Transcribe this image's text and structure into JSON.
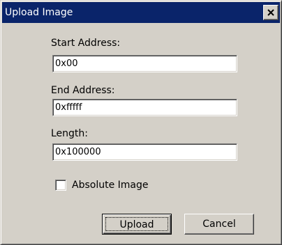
{
  "dialog": {
    "title": "Upload Image",
    "close_icon": "close-x-icon"
  },
  "fields": {
    "start_address": {
      "label": "Start Address:",
      "value": "0x00"
    },
    "end_address": {
      "label": "End Address:",
      "value": "0xfffff"
    },
    "length": {
      "label": "Length:",
      "value": "0x100000"
    }
  },
  "options": {
    "absolute_image": {
      "label": "Absolute Image",
      "checked": false
    }
  },
  "buttons": {
    "upload_label": "Upload",
    "cancel_label": "Cancel"
  },
  "colors": {
    "titlebar": "#0a246a",
    "dialog_face": "#d4d0c8",
    "field_bg": "#ffffff"
  }
}
